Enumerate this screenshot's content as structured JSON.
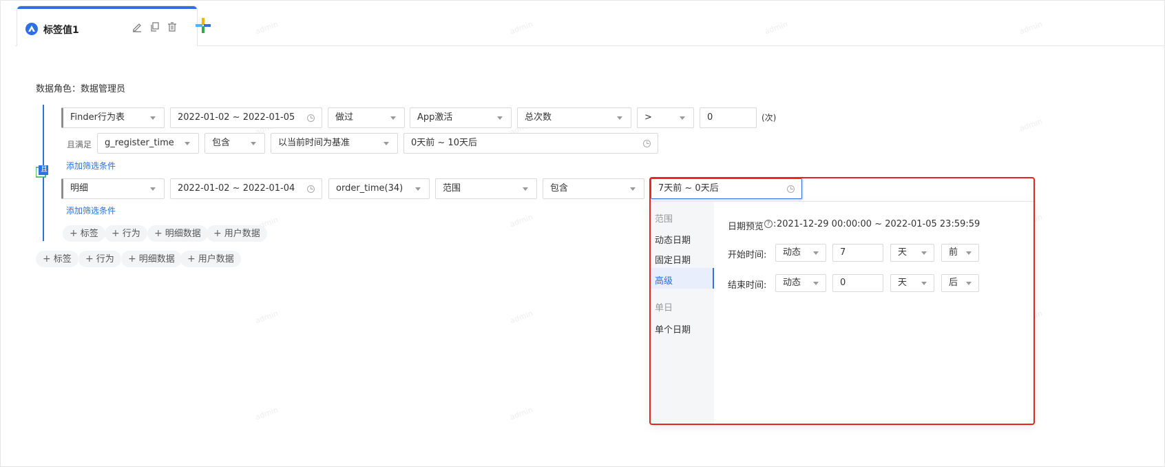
{
  "tab": {
    "title": "标签值1"
  },
  "role": {
    "label": "数据角色：",
    "value": "数据管理员"
  },
  "row1": {
    "source": "Finder行为表",
    "date_range": "2022-01-02 ~ 2022-01-05",
    "verb": "做过",
    "event": "App激活",
    "metric": "总次数",
    "operator": ">",
    "value": "0",
    "unit": "(次)"
  },
  "row1_filter": {
    "prefix": "且满足",
    "field": "g_register_time",
    "op": "包含",
    "base": "以当前时间为基准",
    "range": "0天前 ~ 10天后"
  },
  "add_filter_1": "添加筛选条件",
  "and_label": "且",
  "row2": {
    "source": "明细",
    "date_range": "2022-01-02 ~ 2022-01-04",
    "field": "order_time(34)",
    "type": "范围",
    "op": "包含",
    "range": "7天前 ~ 0天后"
  },
  "add_filter_2": "添加筛选条件",
  "inner_chips": [
    "标签",
    "行为",
    "明细数据",
    "用户数据"
  ],
  "outer_chips": [
    "标签",
    "行为",
    "明细数据",
    "用户数据"
  ],
  "picker": {
    "sidebar": {
      "group_range": "范围",
      "dynamic": "动态日期",
      "fixed": "固定日期",
      "advanced": "高级",
      "group_single": "单日",
      "single": "单个日期"
    },
    "preview_label": "日期预览",
    "preview_value": "2021-12-29 00:00:00 ~ 2022-01-05 23:59:59",
    "start": {
      "label": "开始时间:",
      "mode": "动态",
      "num": "7",
      "unit": "天",
      "dir": "前"
    },
    "end": {
      "label": "结束时间:",
      "mode": "动态",
      "num": "0",
      "unit": "天",
      "dir": "后"
    }
  },
  "watermark": "admin",
  "colors": {
    "accent": "#2f6fe4",
    "highlight": "#e5241d"
  }
}
